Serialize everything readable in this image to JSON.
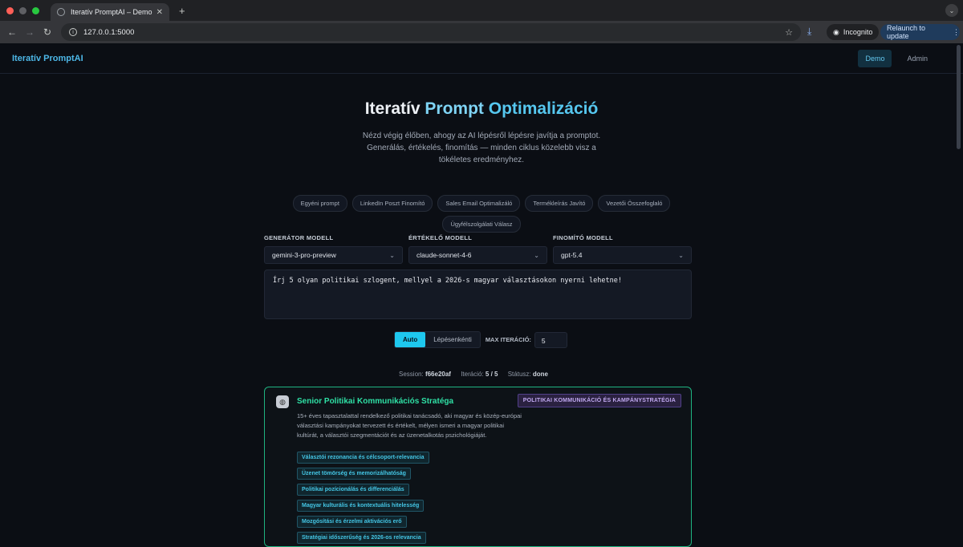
{
  "browser": {
    "tab_title": "Iteratív PromptAI – Demo",
    "url": "127.0.0.1:5000",
    "incognito_label": "Incognito",
    "relaunch_label": "Relaunch to update"
  },
  "header": {
    "brand": "Iteratív PromptAI",
    "nav": [
      {
        "label": "Demo",
        "active": true
      },
      {
        "label": "Admin",
        "active": false
      }
    ]
  },
  "hero": {
    "title_part1": "Iteratív",
    "title_part2": "Prompt",
    "title_part3": "Optimalizáció",
    "subtitle": "Nézd végig élőben, ahogy az AI lépésről lépésre javítja a promptot. Generálás, értékelés, finomítás — minden ciklus közelebb visz a tökéletes eredményhez."
  },
  "presets": [
    "Egyéni prompt",
    "LinkedIn Poszt Finomító",
    "Sales Email Optimalizáló",
    "Termékleírás Javító",
    "Vezetői Összefoglaló",
    "Ügyfélszolgálati Válasz"
  ],
  "models": {
    "generator": {
      "label": "GENERÁTOR MODELL",
      "value": "gemini-3-pro-preview"
    },
    "evaluator": {
      "label": "ÉRTÉKELŐ MODELL",
      "value": "claude-sonnet-4-6"
    },
    "refiner": {
      "label": "FINOMÍTÓ MODELL",
      "value": "gpt-5.4"
    }
  },
  "prompt_text": "Írj 5 olyan politikai szlogent, mellyel a 2026-s magyar választásokon nyerni lehetne!",
  "modes": {
    "auto": "Auto",
    "step": "Lépésenkénti",
    "max_label": "MAX ITERÁCIÓ:",
    "max_value": "5"
  },
  "session": {
    "session_label": "Session:",
    "session_value": "f66e20af",
    "iter_label": "Iteráció:",
    "iter_value": "5 / 5",
    "status_label": "Státusz:",
    "status_value": "done"
  },
  "persona": {
    "title": "Senior Politikai Kommunikációs Stratéga",
    "badge": "POLITIKAI KOMMUNIKÁCIÓ ÉS KAMPÁNYSTRATÉGIA",
    "description": "15+ éves tapasztalattal rendelkező politikai tanácsadó, aki magyar és közép-európai választási kampányokat tervezett és értékelt, mélyen ismeri a magyar politikai kultúrát, a választói szegmentációt és az üzenetalkotás pszichológiáját.",
    "criteria": [
      "Választói rezonancia és célcsoport-relevancia",
      "Üzenet tömörség és memorizálhatóság",
      "Politikai pozícionálás és differenciálás",
      "Magyar kulturális és kontextuális hitelesség",
      "Mozgósítási és érzelmi aktivációs erő",
      "Stratégiai időszerűség és 2026-os relevancia"
    ]
  },
  "colors": {
    "accent": "#1ec8ef",
    "success": "#1fb381",
    "brand": "#4db8e8"
  }
}
